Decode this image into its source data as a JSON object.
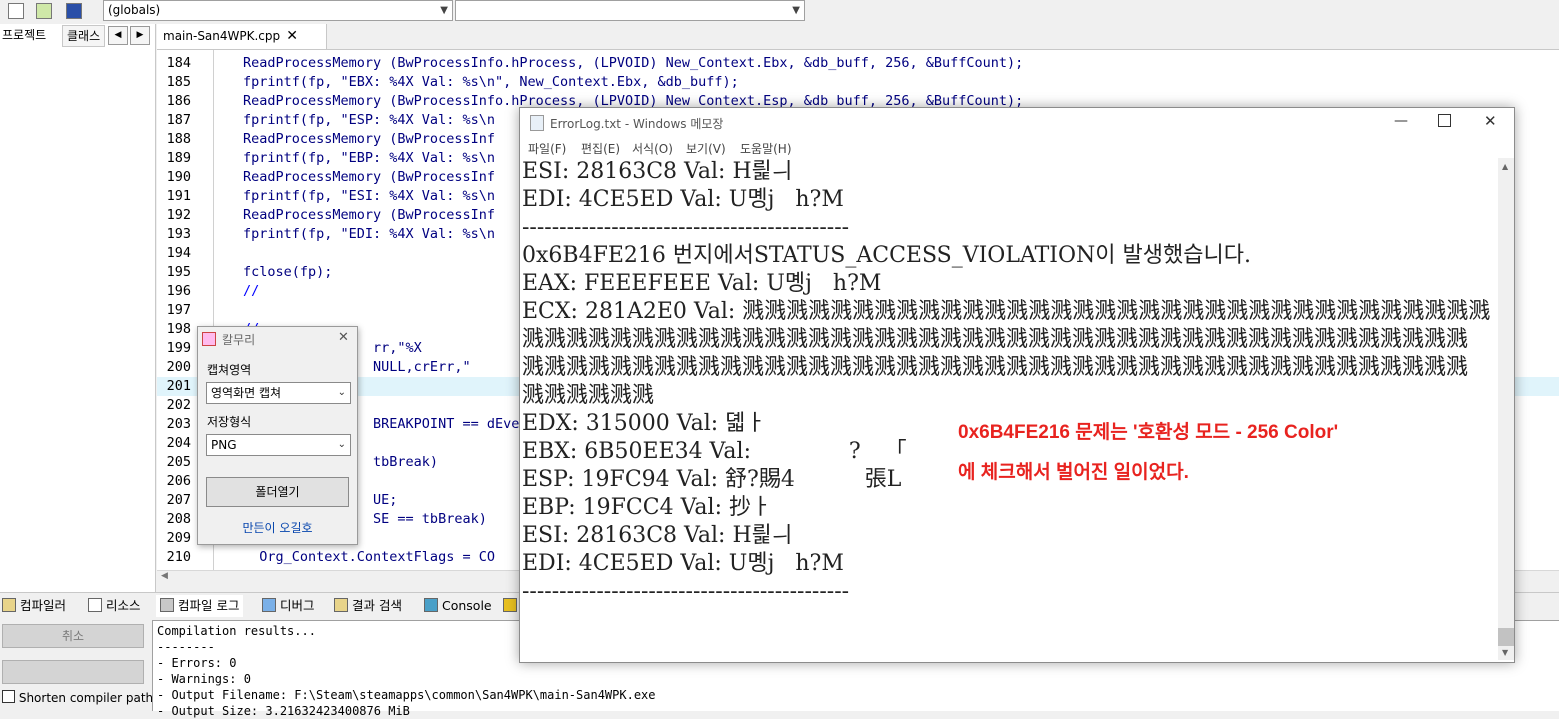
{
  "toolbar": {
    "globals_combo": "(globals)",
    "icons": [
      "project-icon",
      "add-icon",
      "bookmark-icon"
    ]
  },
  "left_panel": {
    "tabs": [
      "프로젝트",
      "클래스"
    ]
  },
  "editor": {
    "file_tab": "main-San4WPK.cpp",
    "lines": [
      {
        "n": "184",
        "text": "ReadProcessMemory (BwProcessInfo.hProcess, (LPVOID) New_Context.Ebx, &db_buff, 256, &BuffCount);"
      },
      {
        "n": "185",
        "text": "fprintf(fp, \"EBX: %4X Val: %s\\n\", New_Context.Ebx, &db_buff);"
      },
      {
        "n": "186",
        "text": "ReadProcessMemory (BwProcessInfo.hProcess, (LPVOID) New_Context.Esp, &db_buff, 256, &BuffCount);"
      },
      {
        "n": "187",
        "text": "fprintf(fp, \"ESP: %4X Val: %s\\n"
      },
      {
        "n": "188",
        "text": "ReadProcessMemory (BwProcessInf"
      },
      {
        "n": "189",
        "text": "fprintf(fp, \"EBP: %4X Val: %s\\n"
      },
      {
        "n": "190",
        "text": "ReadProcessMemory (BwProcessInf"
      },
      {
        "n": "191",
        "text": "fprintf(fp, \"ESI: %4X Val: %s\\n"
      },
      {
        "n": "192",
        "text": "ReadProcessMemory (BwProcessInf"
      },
      {
        "n": "193",
        "text": "fprintf(fp, \"EDI: %4X Val: %s\\n"
      },
      {
        "n": "194",
        "text": ""
      },
      {
        "n": "195",
        "text": "fclose(fp);"
      },
      {
        "n": "196",
        "text": "//"
      },
      {
        "n": "197",
        "text": ""
      },
      {
        "n": "198",
        "text": "//"
      },
      {
        "n": "199",
        "text": "                rr,\"%X"
      },
      {
        "n": "200",
        "text": "                NULL,crErr,\"      S"
      },
      {
        "n": "201",
        "text": ""
      },
      {
        "n": "202",
        "text": ""
      },
      {
        "n": "203",
        "text": "                BREAKPOINT == dEve"
      },
      {
        "n": "204",
        "text": ""
      },
      {
        "n": "205",
        "text": "                tbBreak)"
      },
      {
        "n": "206",
        "text": ""
      },
      {
        "n": "207",
        "text": "                UE;"
      },
      {
        "n": "208",
        "text": "                SE == tbBreak)"
      },
      {
        "n": "209",
        "text": ""
      },
      {
        "n": "210",
        "text": "  Org_Context.ContextFlags = CO"
      }
    ]
  },
  "capture_dialog": {
    "title": "칼무리",
    "area_label": "캡쳐영역",
    "area_value": "영역화면 캡쳐",
    "format_label": "저장형식",
    "format_value": "PNG",
    "open_folder_button": "폴더열기",
    "author_link": "만든이 오길호"
  },
  "notepad": {
    "title": "ErrorLog.txt - Windows 메모장",
    "menu": [
      "파일(F)",
      "편집(E)",
      "서식(O)",
      "보기(V)",
      "도움말(H)"
    ],
    "lines": [
      "ESI: 28163C8 Val: H릝ㅢ",
      "EDI: 4CE5ED Val: U몡j   h?M",
      "--------------------------------------------",
      "0x6B4FE216 번지에서STATUS_ACCESS_VIOLATION이 발생했습니다.",
      "EAX: FEEEFEEE Val: U몡j   h?M",
      "ECX: 281A2E0 Val: 溅溅溅溅溅溅溅溅溅溅溅溅溅溅溅溅溅溅溅溅溅溅溅溅溅溅溅溅溅溅溅溅溅溅",
      "溅溅溅溅溅溅溅溅溅溅溅溅溅溅溅溅溅溅溅溅溅溅溅溅溅溅溅溅溅溅溅溅溅溅溅溅溅溅溅溅溅溅溅",
      "溅溅溅溅溅溅溅溅溅溅溅溅溅溅溅溅溅溅溅溅溅溅溅溅溅溅溅溅溅溅溅溅溅溅溅溅溅溅溅溅溅溅溅",
      "溅溅溅溅溅溅",
      "EDX: 315000 Val: 뎳ㅏ",
      "EBX: 6B50EE34 Val:              ?     ｢",
      "ESP: 19FC94 Val: 舒?賜4          張L",
      "EBP: 19FCC4 Val: 抄ㅏ",
      "ESI: 28163C8 Val: H릝ㅢ",
      "EDI: 4CE5ED Val: U몡j   h?M",
      "--------------------------------------------"
    ]
  },
  "annotation": {
    "line1": "0x6B4FE216 문제는 '호환성 모드 - 256 Color'",
    "line2": "에 체크해서 벌어진 일이었다.",
    "color": "#e8231f"
  },
  "bottom_tabs": [
    "컴파일러",
    "리소스",
    "컴파일 로그",
    "디버그",
    "결과 검색",
    "Console"
  ],
  "bottom_left": {
    "cancel_button": "취소",
    "shorten_checkbox": "Shorten compiler paths"
  },
  "log": {
    "lines": [
      "Compilation results...",
      "--------",
      "- Errors: 0",
      "- Warnings: 0",
      "- Output Filename: F:\\Steam\\steamapps\\common\\San4WPK\\main-San4WPK.exe",
      "- Output Size: 3.21632423400876 MiB"
    ]
  }
}
